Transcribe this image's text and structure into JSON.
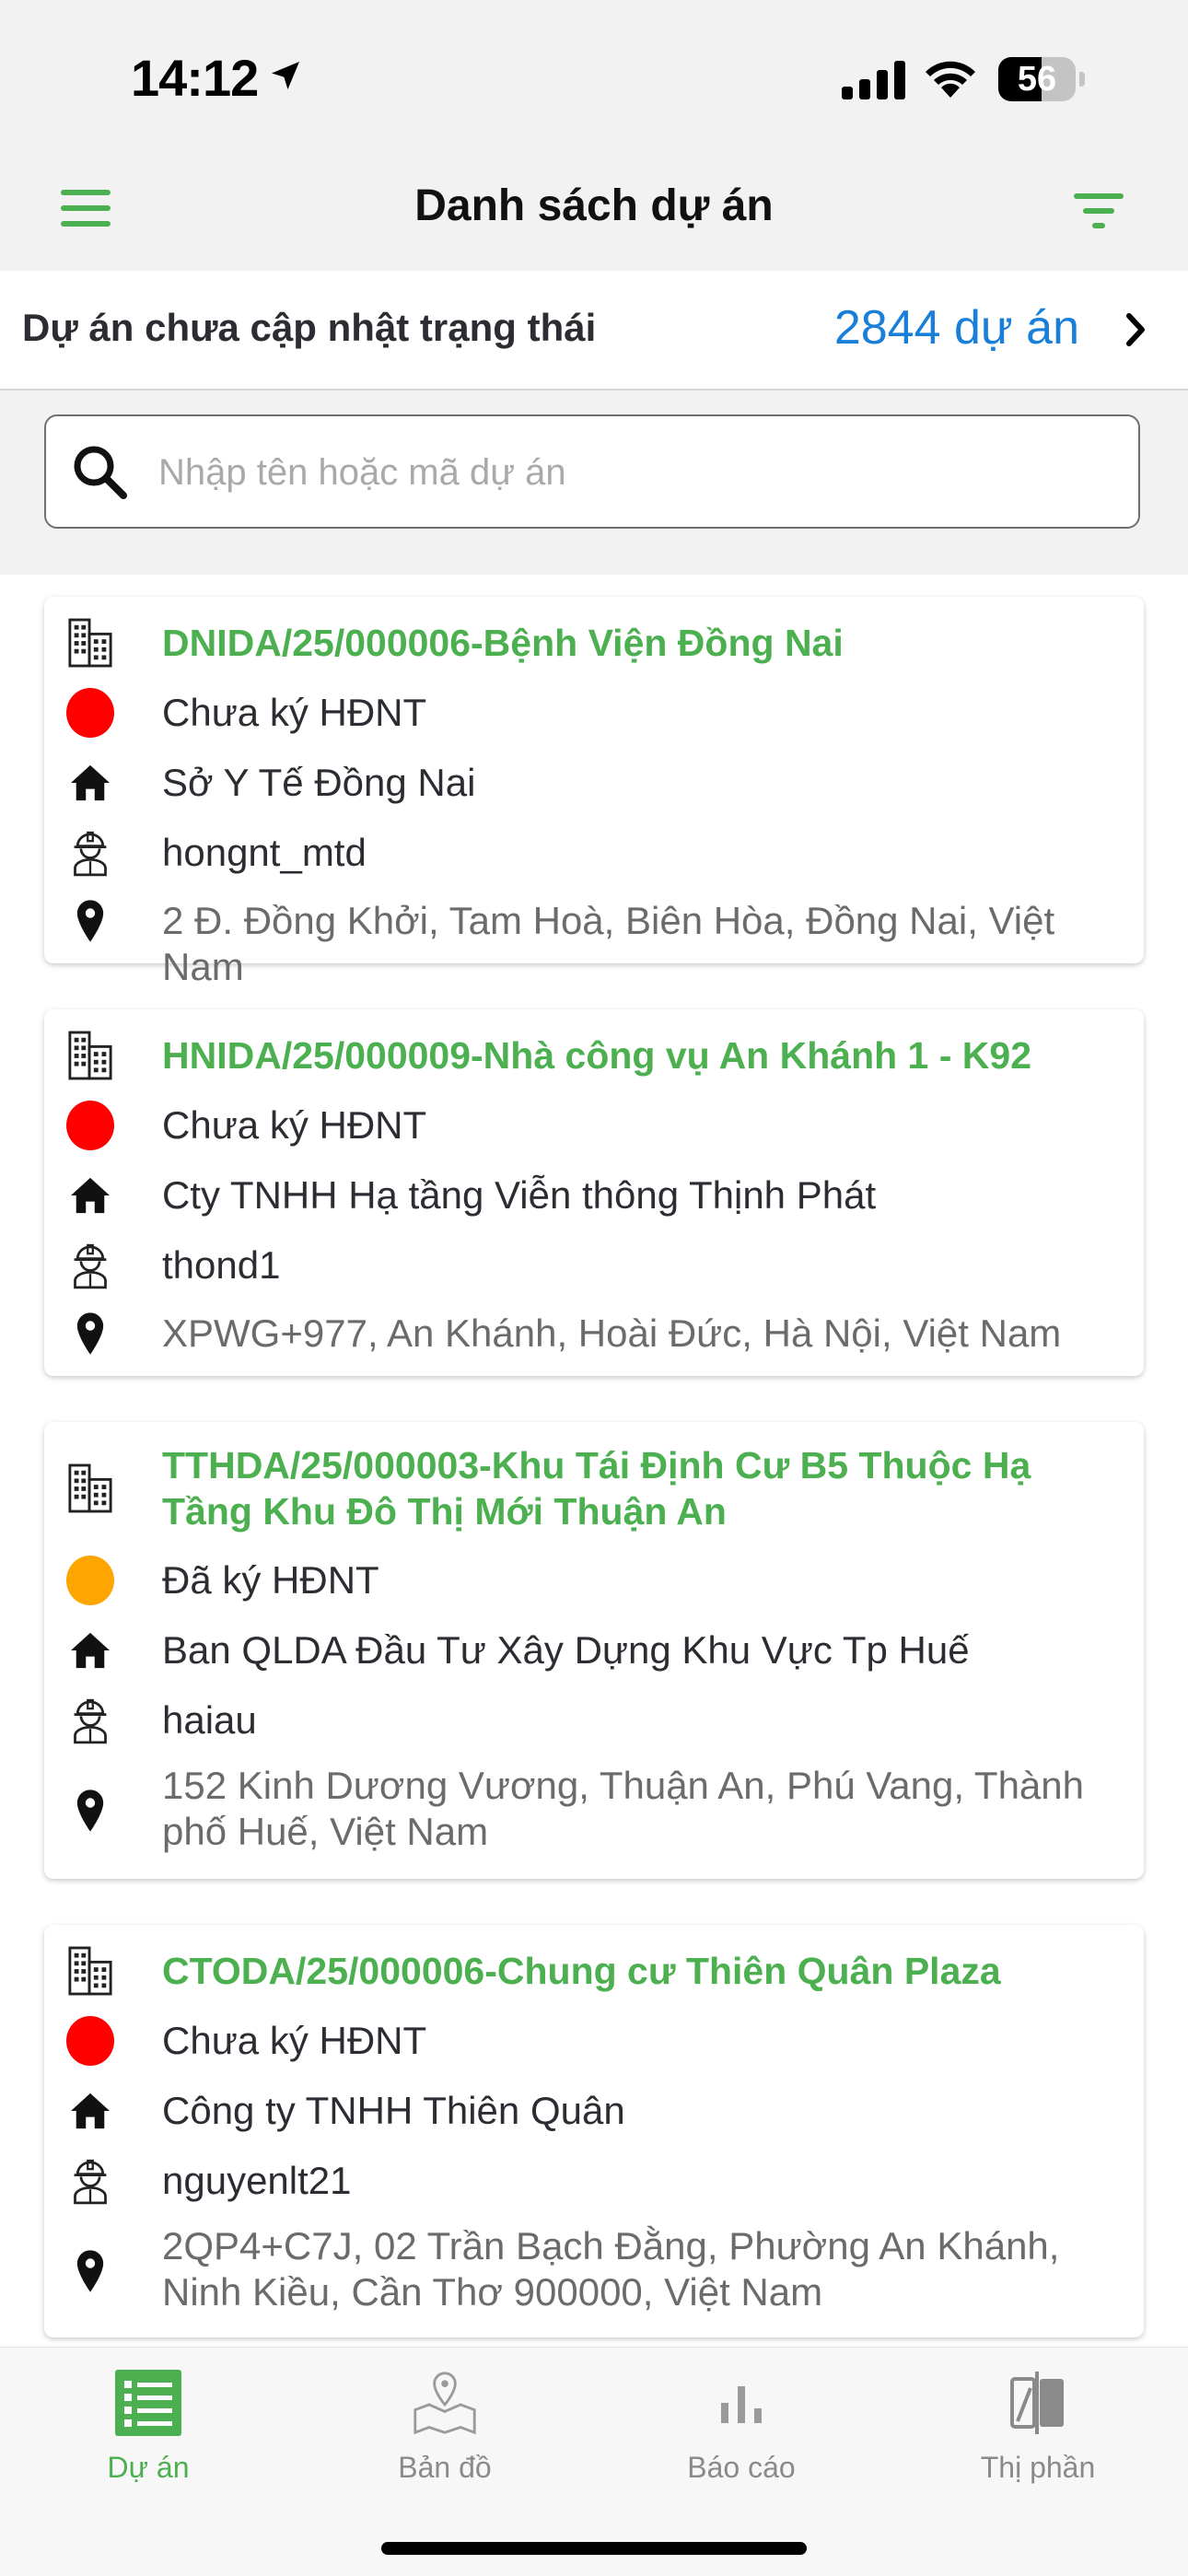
{
  "status_bar": {
    "time": "14:12",
    "battery": "56",
    "battery_level": 0.56
  },
  "header": {
    "title": "Danh sách dự án"
  },
  "pending": {
    "label": "Dự án chưa cập nhật trạng thái",
    "count": "2844 dự án"
  },
  "search": {
    "placeholder": "Nhập tên hoặc mã dự án",
    "value": ""
  },
  "colors": {
    "accent": "#4caf50",
    "link": "#1a7fd8",
    "status_red": "#ff0000",
    "status_orange": "#ffa500"
  },
  "projects": [
    {
      "title": "DNIDA/25/000006-Bệnh Viện Đồng Nai",
      "status": "Chưa ký HĐNT",
      "status_color": "#ff0000",
      "organization": "Sở Y Tế Đồng Nai",
      "user": "hongnt_mtd",
      "address": "2 Đ. Đồng Khởi, Tam Hoà, Biên Hòa, Đồng Nai, Việt Nam"
    },
    {
      "title": "HNIDA/25/000009-Nhà công vụ An Khánh 1 - K92",
      "status": "Chưa ký HĐNT",
      "status_color": "#ff0000",
      "organization": "Cty TNHH Hạ tầng Viễn thông Thịnh Phát",
      "user": "thond1",
      "address": "XPWG+977, An Khánh, Hoài Đức, Hà Nội, Việt Nam"
    },
    {
      "title": "TTHDA/25/000003-Khu Tái Định Cư B5 Thuộc Hạ Tầng Khu Đô Thị Mới Thuận An",
      "status": "Đã ký HĐNT",
      "status_color": "#ffa500",
      "organization": "Ban QLDA Đầu Tư Xây Dựng Khu Vực Tp Huế",
      "user": "haiau",
      "address": "152 Kinh Dương Vương, Thuận An, Phú Vang, Thành phố Huế, Việt Nam"
    },
    {
      "title": "CTODA/25/000006-Chung cư Thiên Quân Plaza",
      "status": "Chưa ký HĐNT",
      "status_color": "#ff0000",
      "organization": "Công ty TNHH Thiên Quân",
      "user": "nguyenlt21",
      "address": "2QP4+C7J, 02 Trần Bạch Đằng, Phường An Khánh, Ninh Kiều, Cần Thơ 900000, Việt Nam"
    }
  ],
  "tabs": [
    {
      "label": "Dự án",
      "icon": "project-list-icon",
      "active": true
    },
    {
      "label": "Bản đồ",
      "icon": "map-icon",
      "active": false
    },
    {
      "label": "Báo cáo",
      "icon": "report-chart-icon",
      "active": false
    },
    {
      "label": "Thị phần",
      "icon": "market-share-icon",
      "active": false
    }
  ]
}
